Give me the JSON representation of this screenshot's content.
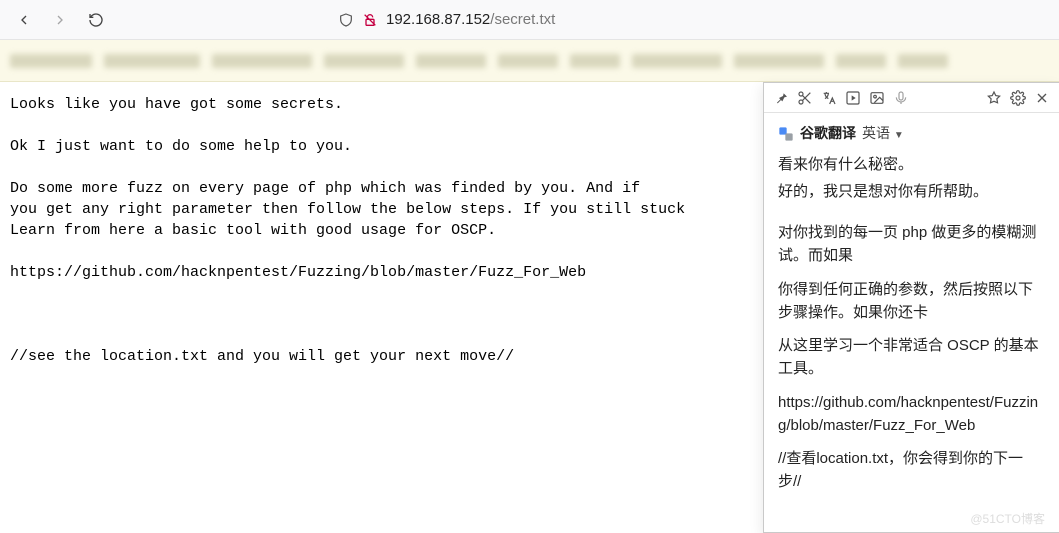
{
  "nav": {
    "url_host": "192.168.87.152",
    "url_path": "/secret.txt"
  },
  "page": {
    "text": "Looks like you have got some secrets.\n\nOk I just want to do some help to you.\n\nDo some more fuzz on every page of php which was finded by you. And if\nyou get any right parameter then follow the below steps. If you still stuck\nLearn from here a basic tool with good usage for OSCP.\n\nhttps://github.com/hacknpentest/Fuzzing/blob/master/Fuzz_For_Web\n\n\n\n//see the location.txt and you will get your next move//"
  },
  "panel": {
    "brand": "谷歌翻译",
    "lang_label": "英语",
    "lines": [
      "看来你有什么秘密。",
      "好的，我只是想对你有所帮助。"
    ],
    "blocks": [
      "对你找到的每一页 php 做更多的模糊测试。而如果",
      "你得到任何正确的参数，然后按照以下步骤操作。如果你还卡",
      "从这里学习一个非常适合 OSCP 的基本工具。",
      "https://github.com/hacknpentest/Fuzzing/blob/master/Fuzz_For_Web",
      "//查看location.txt，你会得到你的下一步//"
    ]
  },
  "watermark": "@51CTO博客"
}
